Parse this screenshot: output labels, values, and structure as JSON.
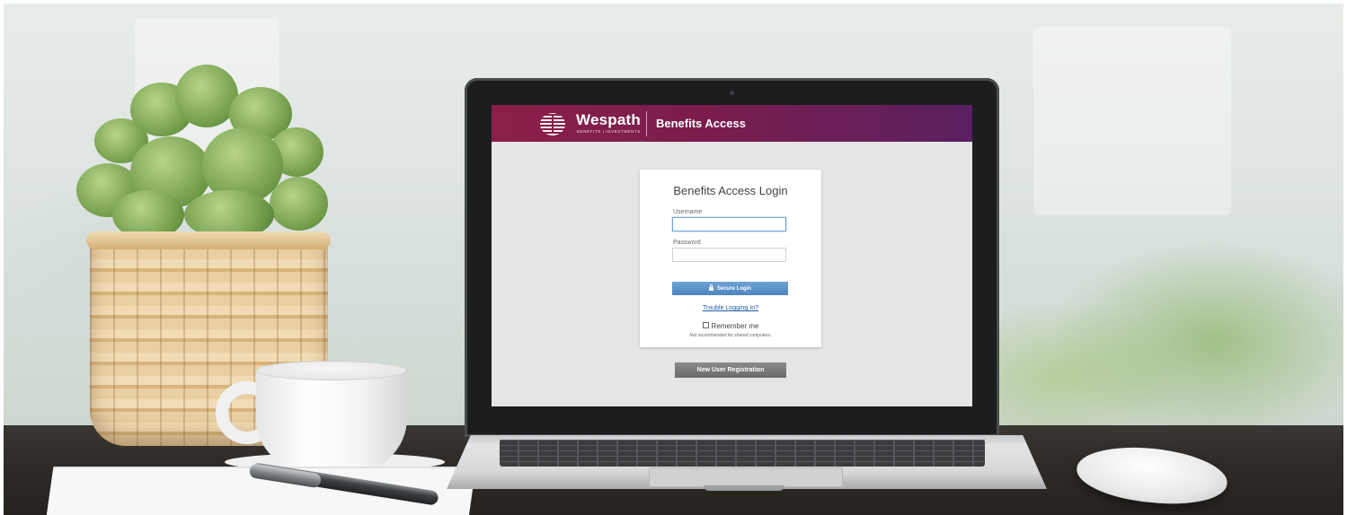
{
  "header": {
    "brand_name": "Wespath",
    "brand_tagline": "BENEFITS | INVESTMENTS",
    "app_title": "Benefits Access"
  },
  "login": {
    "title": "Benefits Access Login",
    "username_label": "Username",
    "username_value": "",
    "password_label": "Password",
    "password_value": "",
    "submit_label": "Secure Login",
    "trouble_link": "Trouble Logging In?",
    "remember_label": "Remember me",
    "remember_note": "Not recommended for shared computers."
  },
  "registration": {
    "button_label": "New User Registration"
  },
  "colors": {
    "header_start": "#8b1f48",
    "header_end": "#5a2061",
    "primary_button": "#5b93c9",
    "secondary_button": "#777777",
    "link": "#1f5aa6"
  },
  "icons": {
    "brand_logo": "wespath-globe-cross-logo",
    "login_button_icon": "lock-icon"
  }
}
